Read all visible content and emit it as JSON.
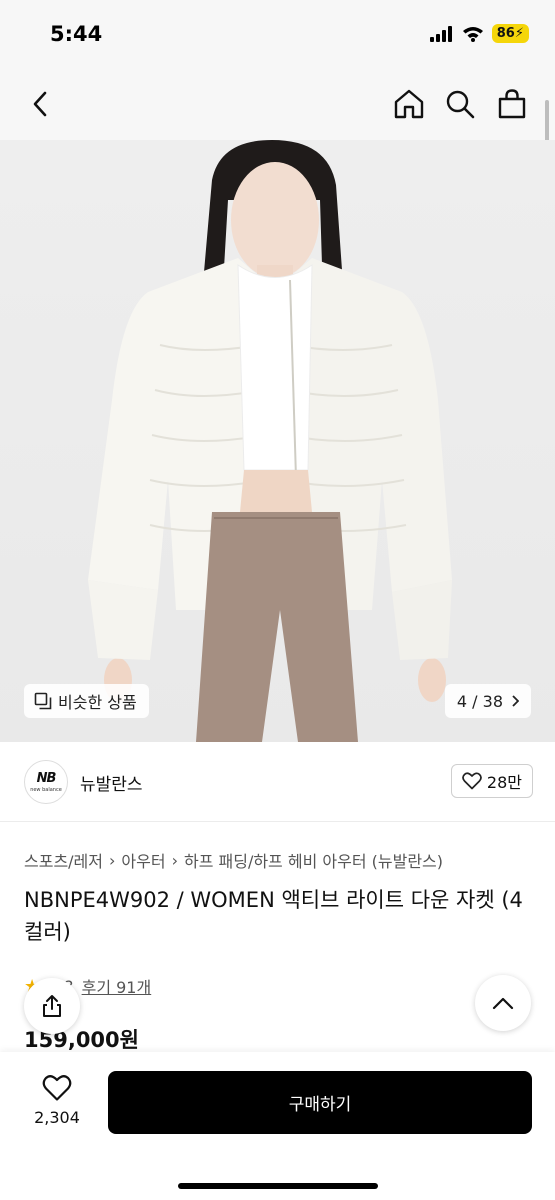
{
  "status_bar": {
    "time": "5:44",
    "battery": "86"
  },
  "hero": {
    "similar_label": "비슷한 상품",
    "counter": "4 / 38"
  },
  "brand": {
    "name": "뉴발란스",
    "logo_text": "NB",
    "logo_sub": "new balance",
    "likes": "28만"
  },
  "breadcrumb": [
    "스포츠/레저",
    "아우터",
    "하프 패딩/하프 헤비 아우터 (뉴발란스)"
  ],
  "product": {
    "title": "NBNPE4W902 / WOMEN 액티브 라이트 다운 자켓 (4컬러)",
    "rating": "4.8",
    "reviews": "후기 91개",
    "price": "159,000원"
  },
  "bottom": {
    "wish_count": "2,304",
    "buy_label": "구매하기"
  },
  "colors": {
    "buy_button": "#000000",
    "battery": "#f5d60a",
    "hero_bg": "#ededed"
  },
  "icons": [
    "signal-icon",
    "wifi-icon",
    "back-icon",
    "home-icon",
    "search-icon",
    "cart-icon",
    "similar-icon",
    "chevron-right-icon",
    "heart-icon",
    "share-icon",
    "chevron-up-icon",
    "star-icon"
  ]
}
